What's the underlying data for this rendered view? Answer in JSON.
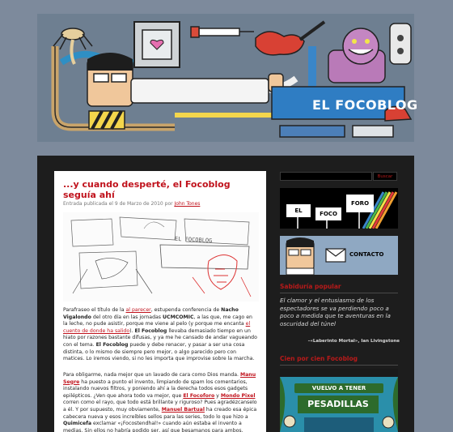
{
  "header": {
    "blog_name": "EL FOCOBLOG"
  },
  "post": {
    "title": "...y cuando desperté, el Focoblog seguía ahí",
    "meta_prefix": "Entrada publicada el 9 de Marzo de 2010 por ",
    "author": "John Tones",
    "sketch_label": "EL FOCOBLOG",
    "p1": {
      "s1": "Parafraseo el título de la ",
      "l1": "al parecer",
      "s2": ", estupenda conferencia de ",
      "b1": "Nacho Vigalondo",
      "s3": " del otro día en las jornadas ",
      "b2": "UCMCOMIC",
      "s4": ", a las que, me cago en la leche, no pude asistir, porque me viene al pelo (y porque me encanta ",
      "l2": "el cuento de donde ha salido",
      "s5": "). ",
      "b3": "El Focoblog",
      "s6": " llevaba demasiado tiempo en un hiato por razones bastante difusas, y ya me he cansado de andar vagueando con el tema. ",
      "b4": "El Focoblog",
      "s7": " puede y debe renacer, y pasar a ser una cosa distinta, o lo mismo de siempre pero mejor, o algo parecido pero con matices. Lo iremos viendo, si no les importa que improvise sobre la marcha."
    },
    "p2": {
      "s1": "Para obligarme, nada mejor que un lavado de cara como Dios manda. ",
      "l1": "Manu Segre",
      "s2": " ha puesto a punto el invento, limpiando de spam los comentarios, instalando nuevos filtros, y poniendo ahí a la derecha todos esos gadgets epilépticos. ¿Ven que ahora todo va mejor, que ",
      "l2": "El Focoforo",
      "s3": " y ",
      "l3": "Mondo Pixel",
      "s4": " corren como el rayo, que todo está brillante y riguroso? Pues agradézcanselo a él. Y por supuesto, muy obviamente, ",
      "l4": "Manuel Bartual",
      "s5": " ha creado esa épica cabecera nueva y esos increíbles sellos para las series, todo lo que hizo a ",
      "b1": "Quimicefa",
      "s6": " exclamar «¡Focostendhal!» cuando aún estaba el invento a medias. Sin ellos no habría podido ser, así que besamanos para ambos."
    }
  },
  "sidebar": {
    "search_placeholder": "",
    "search_button": "Buscar",
    "foro_words": [
      "EL",
      "FOCO",
      "FORO"
    ],
    "contacto": "CONTACTO",
    "section1_title": "Sabiduría popular",
    "quote": "El clamor y el entusiasmo de los espectadores se va perdiendo poco a poco a medida que te aventuras en la oscuridad del túnel",
    "quote_source": "–«Laberinto Mortal», Ian Livingstone",
    "section2_title": "Cien por cien Focoblog",
    "pesadillas_top": "VUELVO A TENER",
    "pesadillas_big": "PESADILLAS"
  },
  "colors": {
    "page_bg": "#7d8a9c",
    "frame_bg": "#1d1d1d",
    "accent_red": "#c0121c",
    "sidebar_title": "#b81a1a"
  }
}
